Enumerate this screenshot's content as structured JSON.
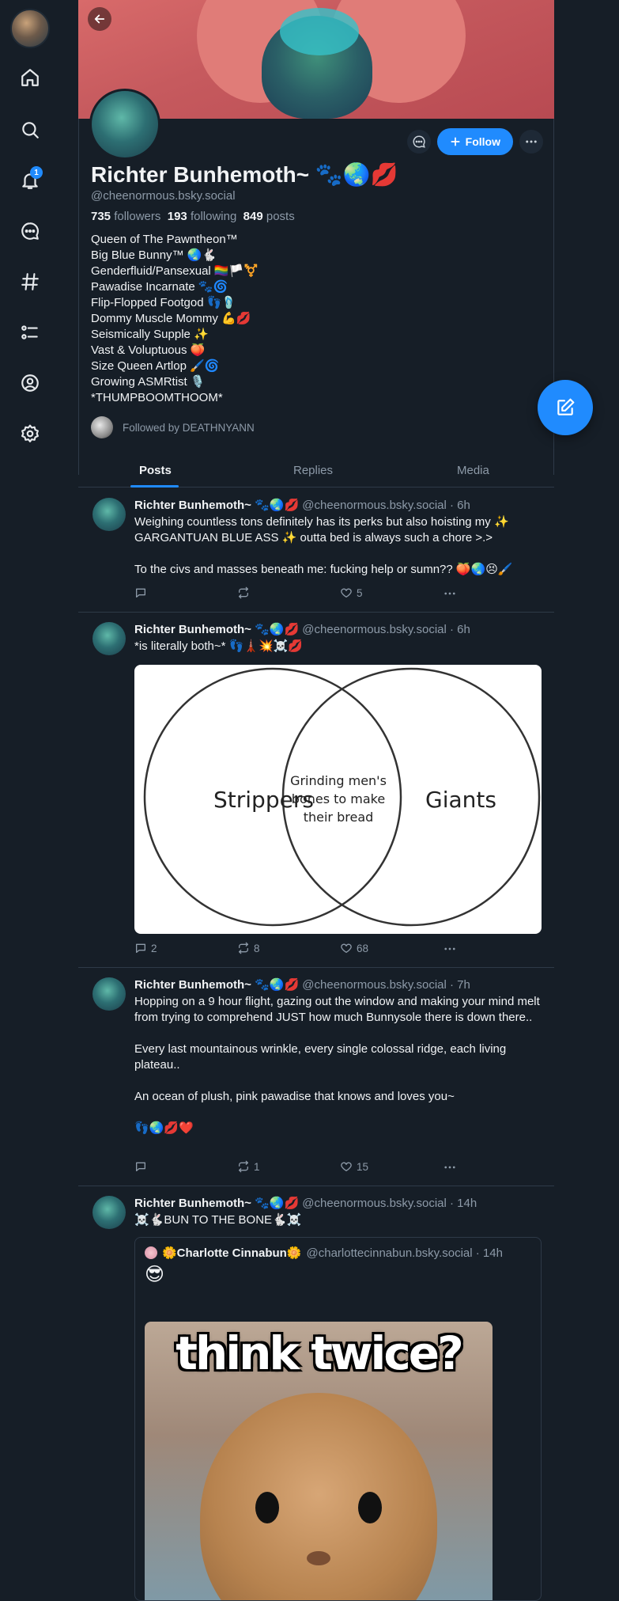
{
  "sidebar": {
    "notifications_badge": "1",
    "items": [
      {
        "icon": "home-icon"
      },
      {
        "icon": "search-icon"
      },
      {
        "icon": "bell-icon"
      },
      {
        "icon": "chat-icon"
      },
      {
        "icon": "hashtag-icon"
      },
      {
        "icon": "list-icon"
      },
      {
        "icon": "profile-icon"
      },
      {
        "icon": "settings-icon"
      }
    ]
  },
  "profile": {
    "display_name": "Richter Bunhemoth~ 🐾🌏💋",
    "handle": "@cheenormous.bsky.social",
    "followers_count": "735",
    "followers_label": "followers",
    "following_count": "193",
    "following_label": "following",
    "posts_count": "849",
    "posts_label": "posts",
    "follow_label": "Follow",
    "bio": [
      "Queen of The Pawntheon™",
      "Big Blue Bunny™ 🌏🐇",
      "Genderfluid/Pansexual 🏳️‍🌈🏳️⚧️",
      "Pawadise Incarnate 🐾🌀",
      "Flip-Flopped Footgod 👣🩴",
      "Dommy Muscle Mommy 💪💋",
      "Seismically Supple ✨",
      "Vast & Voluptuous 🍑",
      "Size Queen Artlop 🖌️🌀",
      "Growing ASMRtist 🎙️",
      "*THUMPBOOMTHOOM*"
    ],
    "followed_by": "Followed by DEATHNYANN"
  },
  "tabs": [
    "Posts",
    "Replies",
    "Media"
  ],
  "posts": [
    {
      "author": "Richter Bunhemoth~ 🐾🌏💋",
      "handle": "@cheenormous.bsky.social · 6h",
      "paragraphs": [
        "Weighing countless tons definitely has its perks but also hoisting my ✨ GARGANTUAN BLUE ASS ✨ outta bed is always such a chore >.>",
        "To the civs and masses beneath me: fucking help or sumn?? 🍑🌏😣🖌️"
      ],
      "replies": "",
      "reposts": "",
      "likes": "5"
    },
    {
      "author": "Richter Bunhemoth~ 🐾🌏💋",
      "handle": "@cheenormous.bsky.social · 6h",
      "paragraphs": [
        "*is literally both~* 👣🗼💥☠️💋"
      ],
      "venn": {
        "left": "Strippers",
        "middle": [
          "Grinding men's",
          "bones to make",
          "their bread"
        ],
        "right": "Giants"
      },
      "replies": "2",
      "reposts": "8",
      "likes": "68"
    },
    {
      "author": "Richter Bunhemoth~ 🐾🌏💋",
      "handle": "@cheenormous.bsky.social · 7h",
      "paragraphs": [
        "Hopping on a 9 hour flight, gazing out the window and making your mind melt from trying to comprehend JUST how much Bunnysole there is down there..",
        "Every last mountainous wrinkle, every single colossal ridge, each living plateau..",
        "An ocean of plush, pink pawadise that knows and loves you~",
        "👣🌏💋❤️"
      ],
      "replies": "",
      "reposts": "1",
      "likes": "15"
    },
    {
      "author": "Richter Bunhemoth~ 🐾🌏💋",
      "handle": "@cheenormous.bsky.social · 14h",
      "paragraphs": [
        "☠️🐇BUN TO THE BONE🐇☠️"
      ],
      "quote": {
        "author": "🌼Charlotte Cinnabun🌼",
        "handle": "@charlottecinnabun.bsky.social · 14h",
        "text": "😎",
        "image_caption": "think twice?"
      }
    }
  ],
  "colors": {
    "background": "#161e27",
    "accent": "#208bfe",
    "muted_text": "#8d9aa8",
    "divider": "#2e3a48"
  }
}
